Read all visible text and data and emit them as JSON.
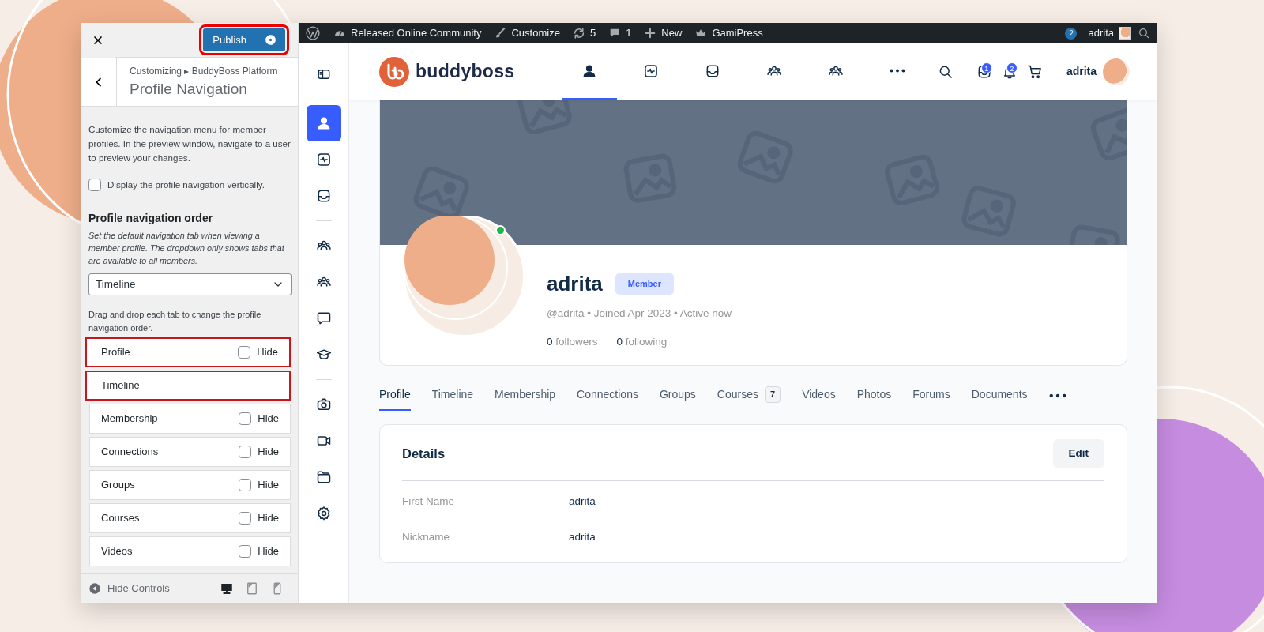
{
  "customizer": {
    "publish": {
      "label": "Publish",
      "highlighted": true
    },
    "breadcrumb": "Customizing ▸ BuddyBoss Platform",
    "title": "Profile Navigation",
    "description": "Customize the navigation menu for member profiles. In the preview window, navigate to a user to preview your changes.",
    "vertical_option": {
      "label": "Display the profile navigation vertically.",
      "checked": false
    },
    "order_heading": "Profile navigation order",
    "order_help": "Set the default navigation tab when viewing a member profile. The dropdown only shows tabs that are available to all members.",
    "default_tab": "Timeline",
    "drag_help": "Drag and drop each tab to change the profile navigation order.",
    "nav_items": [
      {
        "label": "Profile",
        "hide_label": "Hide",
        "hidden": false,
        "highlighted": true
      },
      {
        "label": "Timeline",
        "highlighted": true
      },
      {
        "label": "Membership",
        "hide_label": "Hide",
        "hidden": false,
        "highlighted": false
      },
      {
        "label": "Connections",
        "hide_label": "Hide",
        "hidden": false,
        "highlighted": false
      },
      {
        "label": "Groups",
        "hide_label": "Hide",
        "hidden": false,
        "highlighted": false
      },
      {
        "label": "Courses",
        "hide_label": "Hide",
        "hidden": false,
        "highlighted": false
      },
      {
        "label": "Videos",
        "hide_label": "Hide",
        "hidden": false,
        "highlighted": false
      }
    ],
    "hide_controls": "Hide Controls",
    "devices": [
      {
        "kind": "desktop",
        "selected": true
      },
      {
        "kind": "tablet",
        "selected": false
      },
      {
        "kind": "mobile",
        "selected": false
      }
    ]
  },
  "admin_bar": {
    "items": [
      {
        "kind": "wordpress"
      },
      {
        "kind": "dashboard",
        "label": "Released Online Community"
      },
      {
        "kind": "brush",
        "label": "Customize"
      },
      {
        "kind": "updates",
        "label": "5"
      },
      {
        "kind": "comment",
        "label": "1"
      },
      {
        "kind": "plus",
        "label": "New"
      },
      {
        "kind": "crown",
        "label": "GamiPress"
      }
    ],
    "notification_count": "2",
    "user": "adrita"
  },
  "icon_rail": [
    {
      "kind": "user",
      "selected": true
    },
    {
      "kind": "activity",
      "selected": false
    },
    {
      "kind": "inbox",
      "selected": false
    },
    {
      "kind": "divider"
    },
    {
      "kind": "users",
      "selected": false
    },
    {
      "kind": "users",
      "selected": false
    },
    {
      "kind": "chat",
      "selected": false
    },
    {
      "kind": "cap",
      "selected": false
    },
    {
      "kind": "divider"
    },
    {
      "kind": "camera",
      "selected": false
    },
    {
      "kind": "video",
      "selected": false
    },
    {
      "kind": "folder",
      "selected": false
    },
    {
      "kind": "gear",
      "selected": false
    }
  ],
  "site_header": {
    "logo": "buddyboss",
    "nav": [
      {
        "kind": "user",
        "selected": true
      },
      {
        "kind": "activity",
        "selected": false
      },
      {
        "kind": "inbox",
        "selected": false
      },
      {
        "kind": "users",
        "selected": false
      },
      {
        "kind": "users",
        "selected": false
      },
      {
        "kind": "more",
        "selected": false
      }
    ],
    "messages_count": "1",
    "notifications_count": "2",
    "user": "adrita"
  },
  "profile": {
    "name": "adrita",
    "role": "Member",
    "online": true,
    "meta": "@adrita • Joined Apr 2023 • Active now",
    "followers_count": "0",
    "followers_label": "followers",
    "following_count": "0",
    "following_label": "following"
  },
  "tabs": [
    {
      "label": "Profile",
      "selected": true
    },
    {
      "label": "Timeline",
      "selected": false
    },
    {
      "label": "Membership",
      "selected": false
    },
    {
      "label": "Connections",
      "selected": false
    },
    {
      "label": "Groups",
      "selected": false
    },
    {
      "label": "Courses",
      "count": "7",
      "selected": false
    },
    {
      "label": "Videos",
      "selected": false
    },
    {
      "label": "Photos",
      "selected": false
    },
    {
      "label": "Forums",
      "selected": false
    },
    {
      "label": "Documents",
      "selected": false
    }
  ],
  "details": {
    "title": "Details",
    "edit": "Edit",
    "fields": [
      {
        "label": "First Name",
        "value": "adrita"
      },
      {
        "label": "Nickname",
        "value": "adrita"
      }
    ]
  }
}
